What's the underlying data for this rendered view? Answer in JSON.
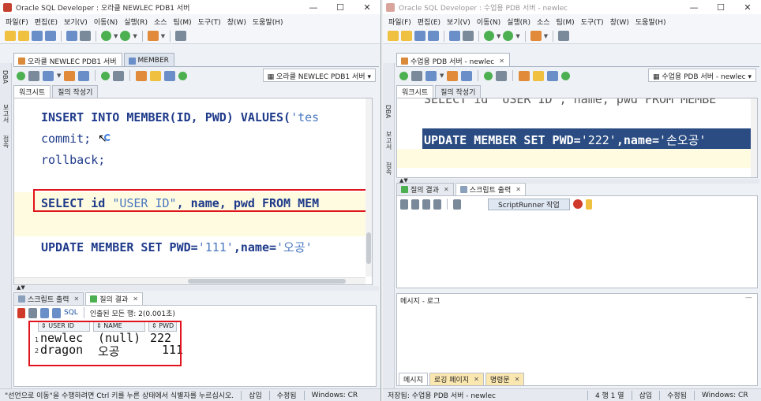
{
  "left": {
    "title": "Oracle SQL Developer : 오라클 NEWLEC PDB1 서버",
    "menu": [
      "파일(F)",
      "편집(E)",
      "보기(V)",
      "이동(N)",
      "실행(R)",
      "소스",
      "팀(M)",
      "도구(T)",
      "창(W)",
      "도움말(H)"
    ],
    "sidebar": [
      "DBA",
      "보고서",
      "접속"
    ],
    "doc_tabs": [
      "오라클 NEWLEC PDB1 서버",
      "MEMBER"
    ],
    "connection": "오라클 NEWLEC PDB1 서버",
    "sub_tabs": [
      "워크시트",
      "질의 작성기"
    ],
    "code": {
      "line1_kw": "INSERT INTO MEMBER(ID, PWD) VALUES(",
      "line1_str": "'tes",
      "line2": "commit;",
      "line3": "rollback;",
      "line4_a": "SELECT id ",
      "line4_str": "\"USER ID\"",
      "line4_b": ", name, pwd FROM MEM",
      "line5_a": "UPDATE MEMBER SET PWD=",
      "line5_str1": "'111'",
      "line5_b": ",name=",
      "line5_str2": "'오공'"
    },
    "output_tabs": [
      "스크립트 출력",
      "질의 결과"
    ],
    "output_toolbar": {
      "sql": "SQL",
      "fetched": "인출된 모든 행: 2(0.001초)"
    },
    "grid": {
      "columns": [
        "USER ID",
        "NAME",
        "PWD"
      ],
      "rows": [
        {
          "num": "1",
          "cells": [
            "newlec",
            "(null)",
            "222"
          ]
        },
        {
          "num": "2",
          "cells": [
            "dragon",
            "오공",
            "111"
          ]
        }
      ]
    },
    "status": {
      "msg": "\"선언으로 이동\"을 수행하려면 Ctrl 키를 누른 상태에서 식별자를 누르십시오.",
      "insert": "삽입",
      "modified": "수정됨",
      "eol": "Windows: CR"
    }
  },
  "right": {
    "title": "Oracle SQL Developer : 수업용 PDB 서버 - newlec",
    "menu": [
      "파일(F)",
      "편집(E)",
      "보기(V)",
      "이동(N)",
      "실행(R)",
      "소스",
      "팀(M)",
      "도구(T)",
      "창(W)",
      "도움말(H)"
    ],
    "sidebar": [
      "DBA",
      "보고서",
      "접속"
    ],
    "doc_tabs": [
      "수업용 PDB 서버 - newlec"
    ],
    "connection": "수업용 PDB 서버 - newlec",
    "sub_tabs": [
      "워크시트",
      "질의 작성기"
    ],
    "code": {
      "line0": "SELECT id \"USER ID\", name, pwd FROM MEMBE",
      "line1_a": "UPDATE MEMBER SET PWD=",
      "line1_str1": "'222'",
      "line1_b": ",name=",
      "line1_str2": "'손오공'"
    },
    "output_tabs": [
      "질의 결과",
      "스크립트 출력"
    ],
    "scriptrunner": "ScriptRunner 작업",
    "log_title": "메시지 - 로그",
    "log_tabs": [
      "메시지",
      "로깅 페이지",
      "명령문"
    ],
    "status": {
      "msg": "저장됨: 수업용 PDB 서버 - newlec",
      "pos": "4 행 1 열",
      "insert": "삽입",
      "modified": "수정됨",
      "eol": "Windows: CR"
    }
  },
  "colors": {
    "highlight_box": "#e0141e",
    "selection": "#2b4c82",
    "keyword": "#1e3a8a",
    "string": "#4a78c0"
  }
}
